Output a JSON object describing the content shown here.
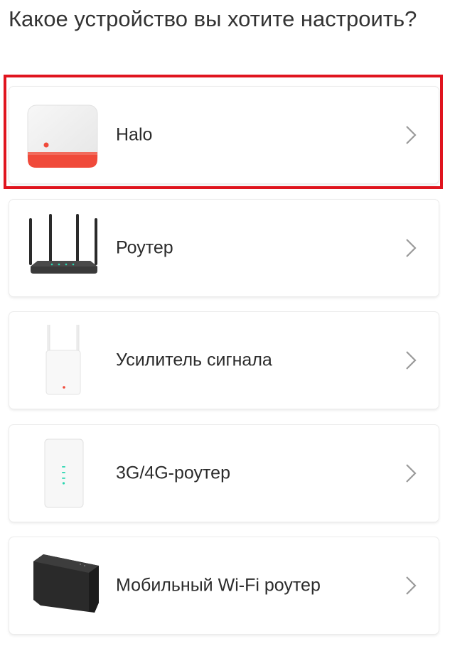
{
  "header": {
    "title": "Какое устройство вы хотите настроить?"
  },
  "devices": [
    {
      "label": "Halo",
      "icon": "halo-device-icon"
    },
    {
      "label": "Роутер",
      "icon": "router-device-icon"
    },
    {
      "label": "Усилитель сигнала",
      "icon": "range-extender-icon"
    },
    {
      "label": "3G/4G-роутер",
      "icon": "lte-router-icon"
    },
    {
      "label": "Мобильный Wi-Fi роутер",
      "icon": "mobile-wifi-router-icon"
    }
  ],
  "colors": {
    "highlight": "#e0141e",
    "halo_band": "#f04a3a",
    "chevron": "#9a9a9a"
  }
}
